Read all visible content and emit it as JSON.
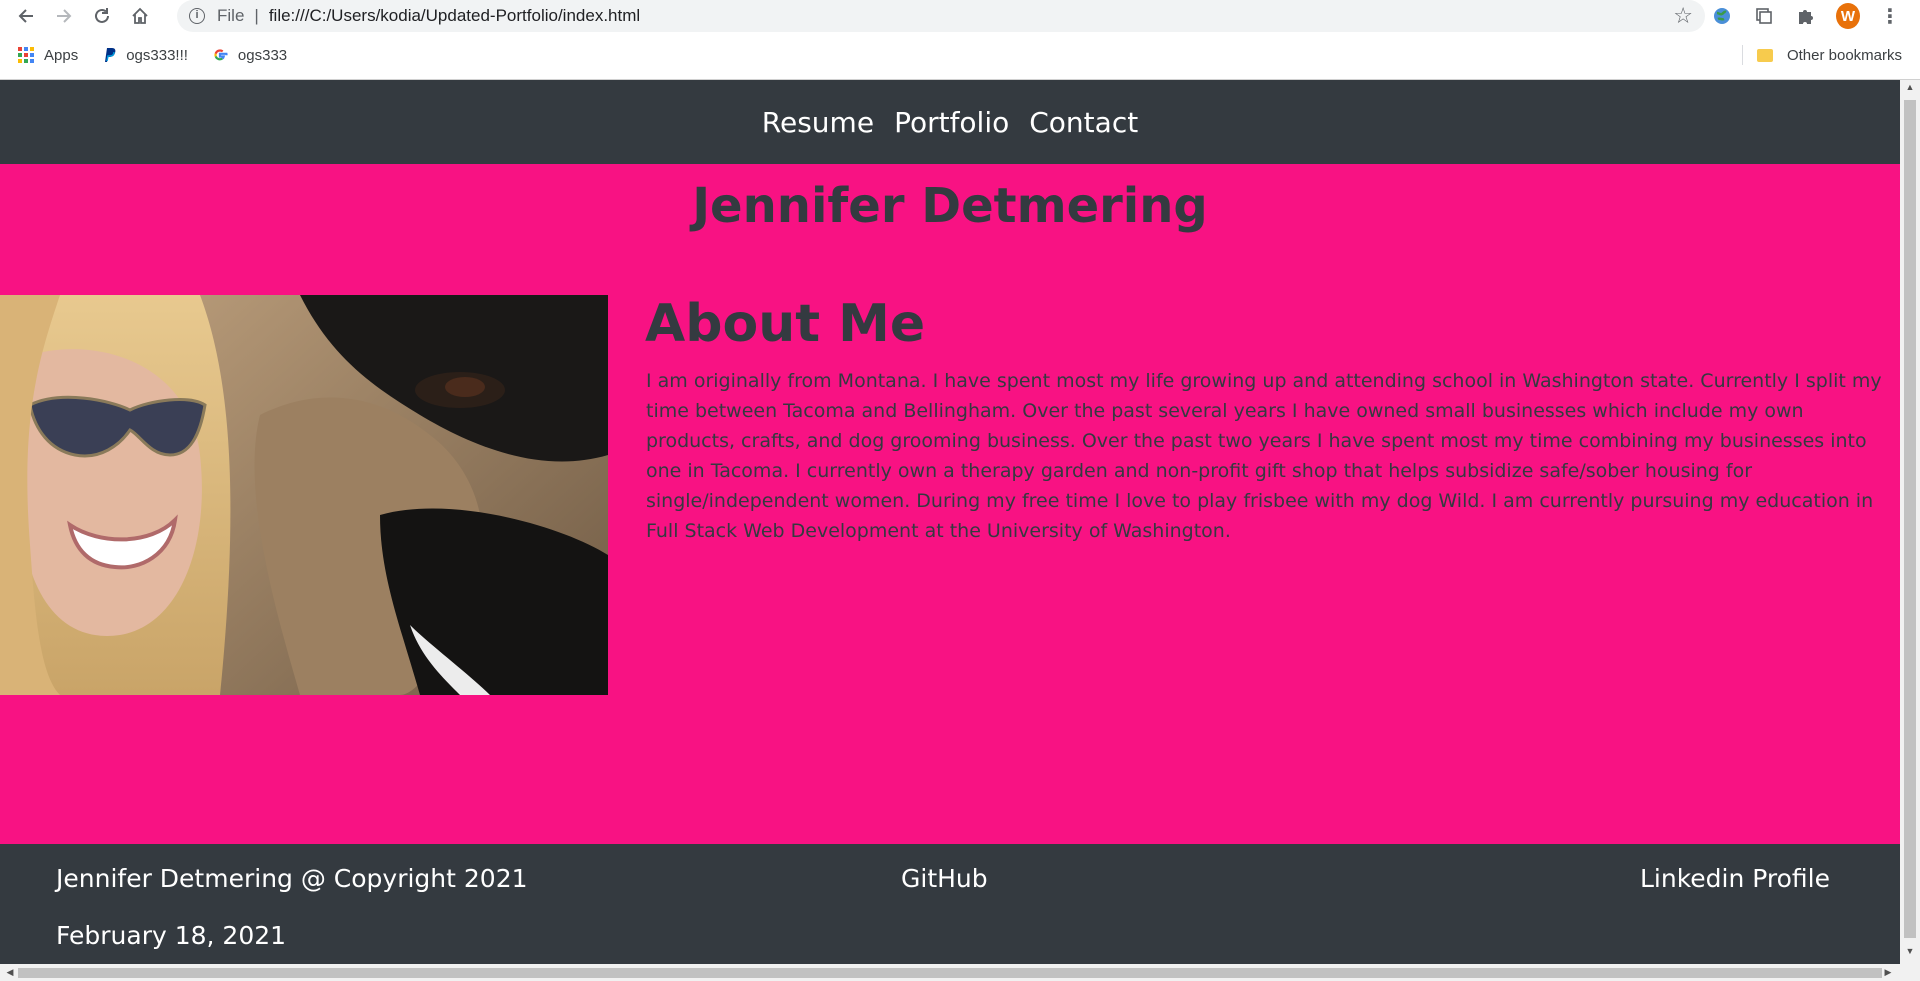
{
  "browser": {
    "scheme_label": "File",
    "url": "file:///C:/Users/kodia/Updated-Portfolio/index.html",
    "profile_initial": "W",
    "bookmarks": [
      {
        "label": "Apps",
        "icon": "apps-grid-icon"
      },
      {
        "label": "ogs333!!!",
        "icon": "paypal-icon"
      },
      {
        "label": "ogs333",
        "icon": "google-icon"
      }
    ],
    "other_bookmarks": "Other bookmarks"
  },
  "site": {
    "nav": [
      "Resume",
      "Portfolio",
      "Contact"
    ],
    "name": "Jennifer Detmering",
    "about_title": "About Me",
    "about_text": "I am originally from Montana. I have spent most my life growing up and attending school in Washington state. Currently I split my time between Tacoma and Bellingham. Over the past several years I have owned small businesses which include my own products, crafts, and dog grooming business. Over the past two years I have spent most my time combining my businesses into one in Tacoma. I currently own a therapy garden and non-profit gift shop that helps subsidize safe/sober housing for single/independent women. During my free time I love to play frisbee with my dog Wild. I am currently pursuing my education in Full Stack Web Development at the University of Washington.",
    "footer": {
      "copyright": "Jennifer Detmering @ Copyright 2021",
      "github": "GitHub",
      "linkedin": "Linkedin Profile",
      "date": "February 18, 2021"
    }
  },
  "colors": {
    "nav_bg": "#343a40",
    "hero_bg": "#f81283",
    "text_dark": "#343a40"
  }
}
